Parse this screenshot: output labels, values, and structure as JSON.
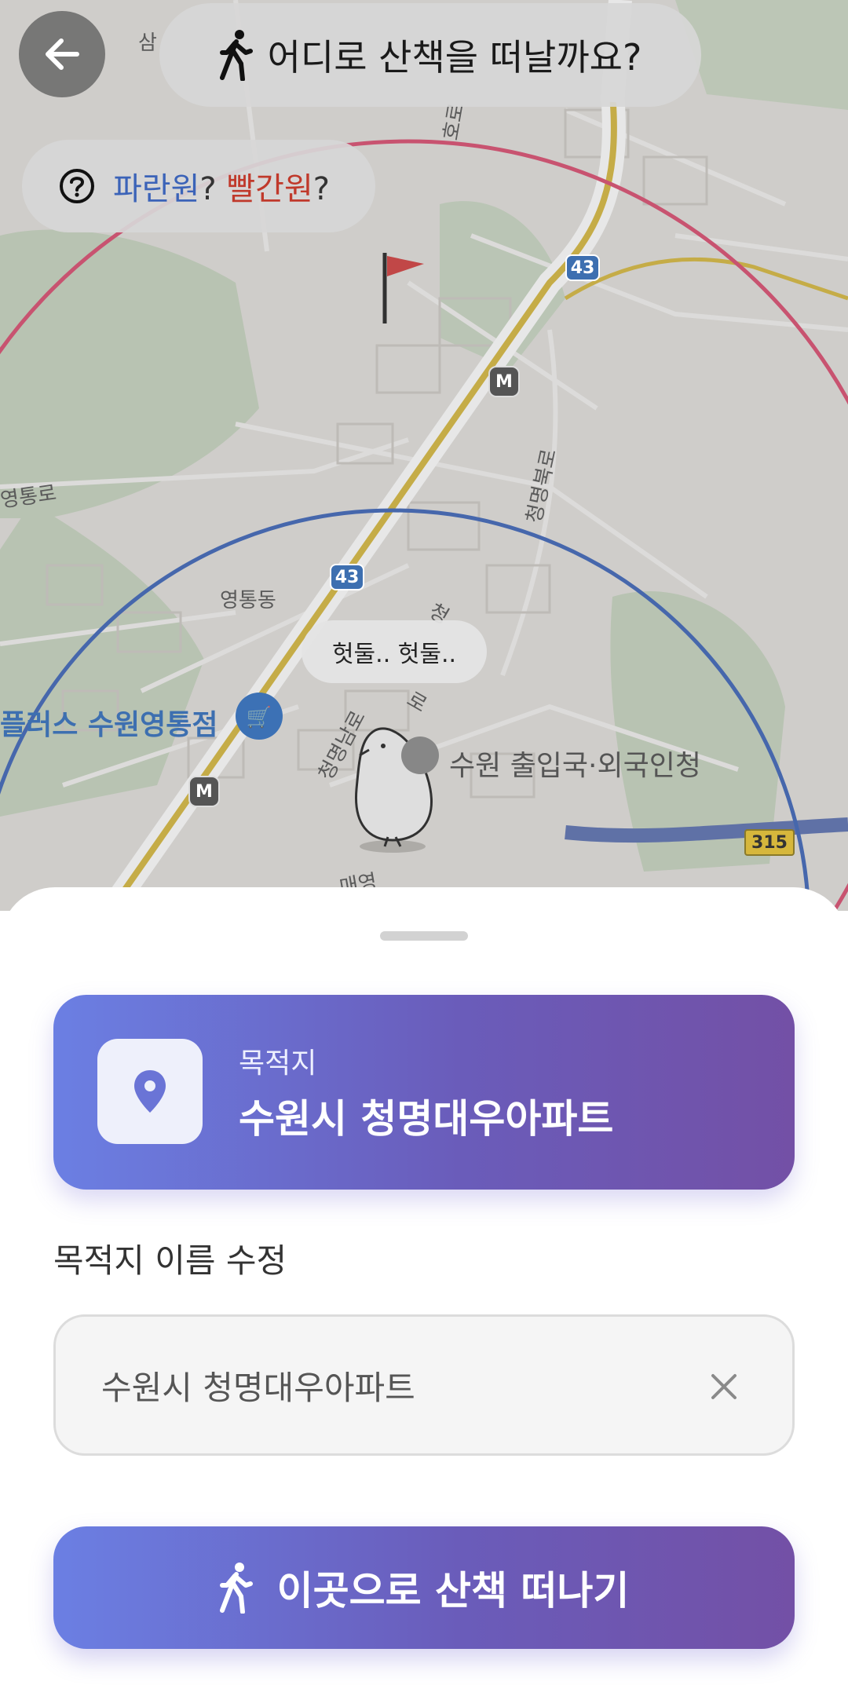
{
  "header": {
    "title": "어디로 산책을 떠날까요?",
    "back_icon": "arrow-left-icon",
    "walk_icon": "walking-person-icon"
  },
  "help": {
    "icon": "question-circle-icon",
    "blue_text": "파란원",
    "q1": "?",
    "red_text": "빨간원",
    "q2": "?"
  },
  "map": {
    "labels": {
      "top_left": "삼",
      "road_top": "호로",
      "yeongtong_ro": "영통로",
      "cheongmyeong_bukro": "청명북로",
      "yeongtong_dong": "영통동",
      "cheongmyeong_namro": "청명남로",
      "cheong": "청",
      "ro": "로",
      "maeyeong": "매영",
      "store": "플러스 수원영통점",
      "immigration": "수원 출입국·외국인청"
    },
    "badges": {
      "route_43": "43",
      "route_315": "315",
      "metro": "M"
    },
    "speech": "헛둘.. 헛둘..",
    "colors": {
      "blue_circle": "#3b63b8",
      "red_circle": "#d94b6e",
      "route_yellow": "#d6b73c"
    }
  },
  "destination": {
    "caption": "목적지",
    "name": "수원시 청명대우아파트",
    "icon": "location-pin-icon"
  },
  "edit": {
    "label": "목적지 이름 수정",
    "value": "수원시 청명대우아파트",
    "clear_icon": "close-icon"
  },
  "action": {
    "label": "이곳으로 산책 떠나기",
    "icon": "walking-person-icon"
  },
  "theme": {
    "gradient_start": "#6b7fe3",
    "gradient_end": "#7350a6"
  }
}
